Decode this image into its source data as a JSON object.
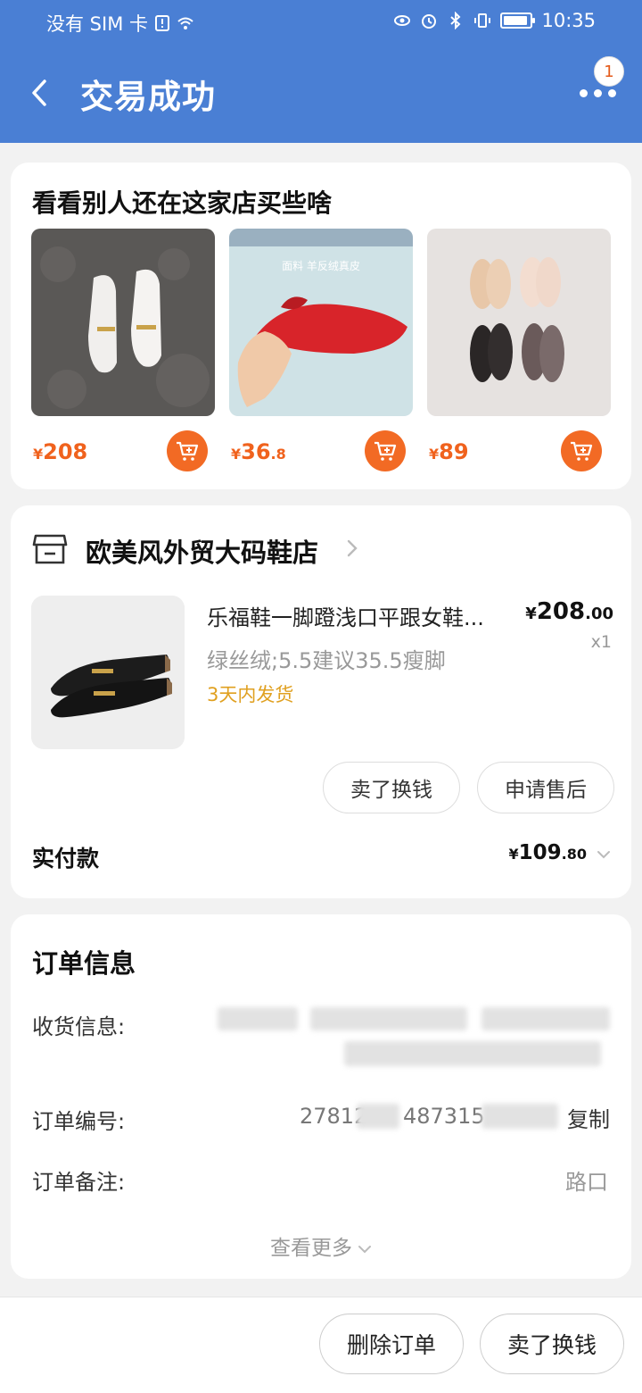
{
  "status_bar": {
    "carrier": "没有 SIM 卡",
    "time": "10:35"
  },
  "header": {
    "title": "交易成功",
    "notification_count": "1"
  },
  "recommend": {
    "title": "看看别人还在这家店买些啥",
    "items": [
      {
        "currency": "¥",
        "price_int": "208",
        "price_dec": "",
        "image_text": ""
      },
      {
        "currency": "¥",
        "price_int": "36",
        "price_dec": ".8",
        "image_text": "面料 羊反绒真皮"
      },
      {
        "currency": "¥",
        "price_int": "89",
        "price_dec": "",
        "image_text": ""
      }
    ]
  },
  "order": {
    "shop_name": "欧美风外贸大码鞋店",
    "product": {
      "name": "乐福鞋一脚蹬浅口平跟女鞋...",
      "currency": "¥",
      "price_int": "208",
      "price_dec": ".00",
      "quantity": "x1",
      "sku": "绿丝绒;5.5建议35.5瘦脚",
      "shipping": "3天内发货"
    },
    "actions": {
      "sell": "卖了换钱",
      "after_sale": "申请售后"
    },
    "paid": {
      "label": "实付款",
      "currency": "¥",
      "amount_int": "109",
      "amount_dec": ".80"
    }
  },
  "order_info": {
    "title": "订单信息",
    "shipping_label": "收货信息:",
    "order_no_label": "订单编号:",
    "order_no_visible": "27812",
    "order_no_mid": "487315",
    "copy_label": "复制",
    "remark_label": "订单备注:",
    "remark_value": "路口",
    "see_more": "查看更多"
  },
  "bottom_bar": {
    "delete_label": "删除订单",
    "sell_label": "卖了换钱"
  },
  "colors": {
    "header_bg": "#4a7fd4",
    "price_orange": "#f0621d",
    "shipping_yellow": "#e0a020"
  }
}
